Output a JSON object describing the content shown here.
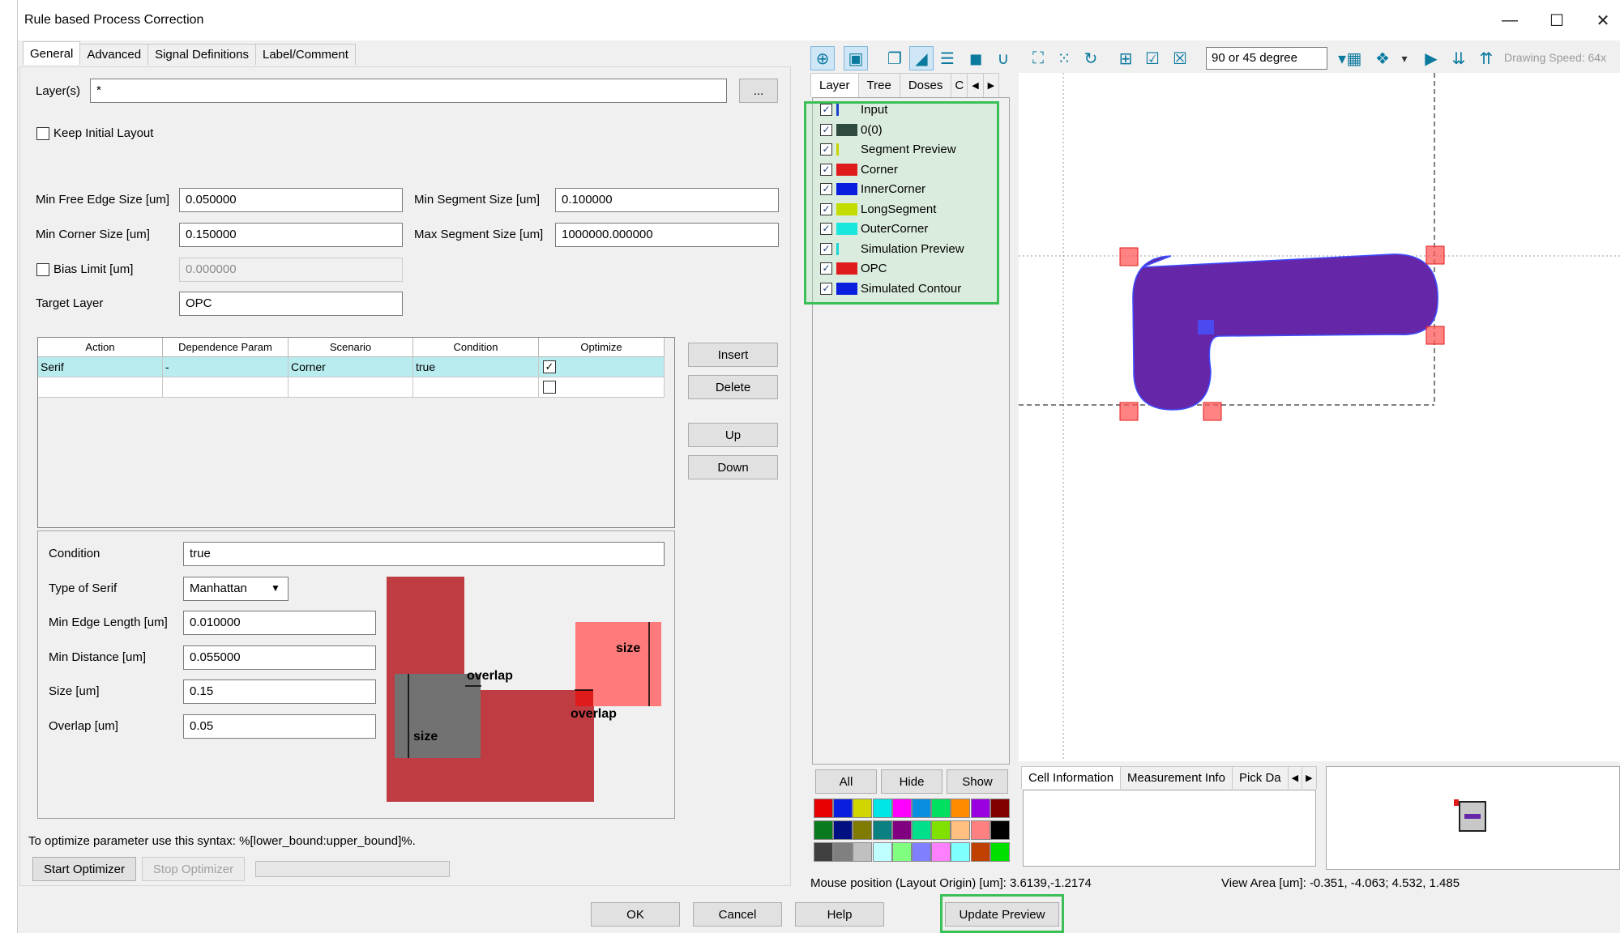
{
  "window": {
    "title": "Rule based Process Correction",
    "minimize_glyph": "—",
    "maximize_glyph": "☐",
    "close_glyph": "✕"
  },
  "tabs": [
    "General",
    "Advanced",
    "Signal Definitions",
    "Label/Comment"
  ],
  "general": {
    "layers_label": "Layer(s)",
    "layers_value": "*",
    "layers_browse": "...",
    "keep_initial_layout": "Keep Initial Layout",
    "min_free_edge_label": "Min Free Edge Size [um]",
    "min_free_edge_value": "0.050000",
    "min_segment_label": "Min Segment Size [um]",
    "min_segment_value": "0.100000",
    "min_corner_label": "Min Corner Size [um]",
    "min_corner_value": "0.150000",
    "max_segment_label": "Max Segment Size [um]",
    "max_segment_value": "1000000.000000",
    "bias_limit_label": "Bias Limit [um]",
    "bias_limit_value": "0.000000",
    "target_layer_label": "Target Layer",
    "target_layer_value": "OPC"
  },
  "rules_table": {
    "columns": [
      "Action",
      "Dependence Param",
      "Scenario",
      "Condition",
      "Optimize"
    ],
    "rows": [
      {
        "action": "Serif",
        "dependence": "-",
        "scenario": "Corner",
        "condition": "true",
        "optimize": true
      },
      {
        "action": "",
        "dependence": "",
        "scenario": "",
        "condition": "",
        "optimize": false
      }
    ],
    "insert": "Insert",
    "delete": "Delete",
    "up": "Up",
    "down": "Down"
  },
  "serif": {
    "condition_label": "Condition",
    "condition_value": "true",
    "type_label": "Type of Serif",
    "type_value": "Manhattan",
    "min_edge_label": "Min Edge Length [um]",
    "min_edge_value": "0.010000",
    "min_distance_label": "Min Distance [um]",
    "min_distance_value": "0.055000",
    "size_label": "Size [um]",
    "size_value": "0.15",
    "overlap_label": "Overlap [um]",
    "overlap_value": "0.05",
    "diagram": {
      "overlap1": "overlap",
      "size1": "size",
      "size2": "size",
      "overlap2": "overlap"
    }
  },
  "optimizer": {
    "hint": "To optimize parameter use this syntax: %[lower_bound:upper_bound]%.",
    "start": "Start Optimizer",
    "stop": "Stop Optimizer"
  },
  "toolbar": {
    "angle_mode": "90 or 45 degree",
    "drawing_speed": "Drawing Speed: 64x"
  },
  "layer_panel": {
    "tabs": [
      "Layer",
      "Tree",
      "Doses",
      "C"
    ],
    "layers": [
      {
        "name": "Input",
        "color": "#1a3dcc",
        "thin": true
      },
      {
        "name": "0(0)",
        "color": "#2f4a3f",
        "thin": false
      },
      {
        "name": "Segment Preview",
        "color": "#c9d400",
        "thin": true
      },
      {
        "name": "Corner",
        "color": "#e01b1b",
        "thin": false
      },
      {
        "name": "InnerCorner",
        "color": "#0a1ee0",
        "thin": false
      },
      {
        "name": "LongSegment",
        "color": "#c4dd00",
        "thin": false
      },
      {
        "name": "OuterCorner",
        "color": "#19e6dd",
        "thin": false
      },
      {
        "name": "Simulation Preview",
        "color": "#19d6d6",
        "thin": true
      },
      {
        "name": "OPC",
        "color": "#e01b1b",
        "thin": false
      },
      {
        "name": "Simulated Contour",
        "color": "#0a1ee0",
        "thin": false
      }
    ],
    "all": "All",
    "hide": "Hide",
    "show": "Show",
    "palette": [
      "#e60000",
      "#0a1ee0",
      "#d2d600",
      "#00e6e6",
      "#ff00ff",
      "#0a8ee0",
      "#00e060",
      "#ff8c00",
      "#9b00e0",
      "#800000",
      "#0a7a1e",
      "#001080",
      "#807a00",
      "#0a8080",
      "#800080",
      "#00e08a",
      "#80e000",
      "#ffc080",
      "#ff8080",
      "#000000",
      "#404040",
      "#808080",
      "#c0c0c0",
      "#c0ffff",
      "#80ff80",
      "#8080ff",
      "#ff80ff",
      "#80ffff",
      "#c04000",
      "#00e000"
    ]
  },
  "cell_tabs": [
    "Cell Information",
    "Measurement Info",
    "Pick Da"
  ],
  "status": {
    "mouse_position": "Mouse position (Layout Origin) [um]: 3.6139,-1.2174",
    "view_area": "View Area [um]: -0.351, -4.063; 4.532, 1.485"
  },
  "footer": {
    "ok": "OK",
    "cancel": "Cancel",
    "help": "Help",
    "update_preview": "Update Preview"
  }
}
